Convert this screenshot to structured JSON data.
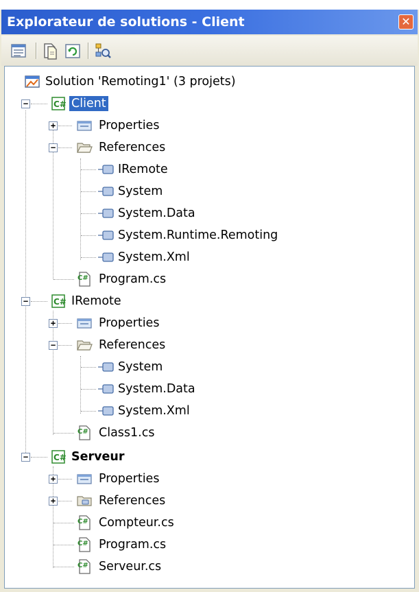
{
  "window": {
    "title": "Explorateur de solutions - Client",
    "close_glyph": "✕"
  },
  "toolbar": {
    "buttons": [
      {
        "icon": "properties-icon"
      },
      {
        "icon": "show-all-files-icon"
      },
      {
        "icon": "refresh-icon"
      },
      {
        "icon": "class-view-icon"
      }
    ]
  },
  "tree": {
    "solution": "Solution 'Remoting1' (3 projets)",
    "projects": [
      {
        "name": "Client",
        "properties": "Properties",
        "references": "References",
        "refs": [
          "IRemote",
          "System",
          "System.Data",
          "System.Runtime.Remoting",
          "System.Xml"
        ],
        "files": [
          "Program.cs"
        ]
      },
      {
        "name": "IRemote",
        "properties": "Properties",
        "references": "References",
        "refs": [
          "System",
          "System.Data",
          "System.Xml"
        ],
        "files": [
          "Class1.cs"
        ]
      },
      {
        "name": "Serveur",
        "properties": "Properties",
        "references": "References",
        "refs": [],
        "files": [
          "Compteur.cs",
          "Program.cs",
          "Serveur.cs"
        ]
      }
    ]
  },
  "colors": {
    "title_gradient_start": "#2b5dcd",
    "title_gradient_end": "#6b98ec",
    "selection": "#316ac5",
    "csharp_icon": "#2e8b2e"
  }
}
